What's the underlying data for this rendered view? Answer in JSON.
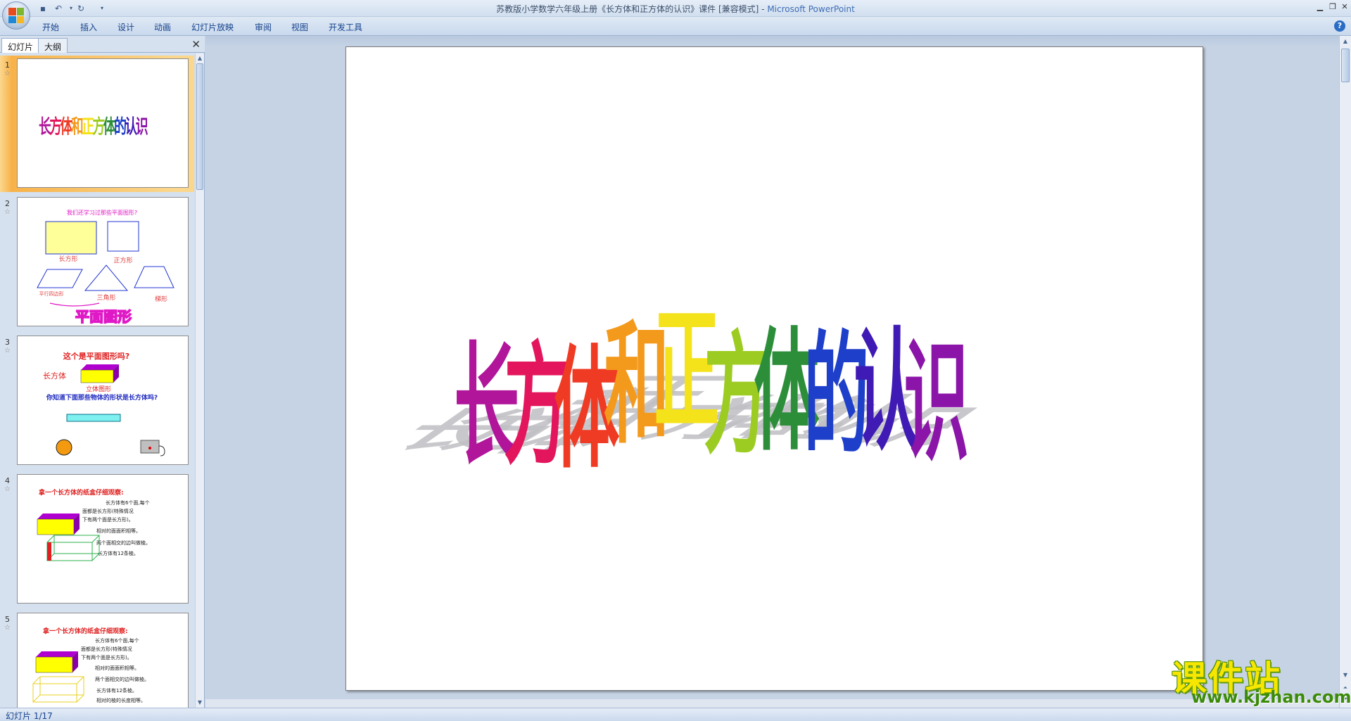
{
  "window": {
    "title": "苏教版小学数学六年级上册《长方体和正方体的认识》课件 [兼容模式]",
    "title_separator": " - ",
    "app_name": "Microsoft PowerPoint"
  },
  "ribbon": {
    "tabs": [
      "开始",
      "插入",
      "设计",
      "动画",
      "幻灯片放映",
      "审阅",
      "视图",
      "开发工具"
    ]
  },
  "left_pane": {
    "tabs": [
      "幻灯片",
      "大纲"
    ],
    "close_glyph": "✕",
    "slides": [
      {
        "number": "1",
        "selected": true
      },
      {
        "number": "2",
        "selected": false,
        "question": "我们还学习过那些平面图形?",
        "labels": [
          "长方形",
          "正方形",
          "平行四边形",
          "三角形",
          "梯形"
        ],
        "caption": "平面图形"
      },
      {
        "number": "3",
        "selected": false,
        "question": "这个是平面图形吗?",
        "label_left": "长方体",
        "label_mid": "立体图形",
        "question2": "你知道下面那些物体的形状是长方体吗?"
      },
      {
        "number": "4",
        "selected": false,
        "heading": "拿一个长方体的纸盒仔细观察:",
        "notes": [
          "长方体有6个面,每个",
          "面都是长方形(特殊情况",
          "下有两个面是长方形)。",
          "相对的面面积相等。",
          "两个面相交的边叫做棱。",
          "长方体有12条棱。"
        ]
      },
      {
        "number": "5",
        "selected": false,
        "heading": "拿一个长方体的纸盒仔细观察:",
        "notes": [
          "长方体有6个面,每个",
          "面都是长方形(特殊情况",
          "下有两个面是长方形)。",
          "相对的面面积相等。",
          "两个面相交的边叫做棱。",
          "长方体有12条棱。",
          "相对的棱的长度相等。"
        ]
      }
    ]
  },
  "main_slide": {
    "wordart_chars": [
      "长",
      "方",
      "体",
      "和",
      "正",
      "方",
      "体",
      "的",
      "认",
      "识"
    ],
    "wordart_colors": [
      "#b0159a",
      "#e3155c",
      "#ef3a24",
      "#f39a1c",
      "#f4e21a",
      "#9ccc22",
      "#2d8e3a",
      "#1e3fc9",
      "#3f1ab4",
      "#8b14a9"
    ],
    "thumb_title": "长方体和正方体的认识"
  },
  "status": {
    "slide_indicator": "幻灯片 1/17"
  },
  "watermark": {
    "big": "课件站",
    "url": "www.kjzhan.com"
  }
}
